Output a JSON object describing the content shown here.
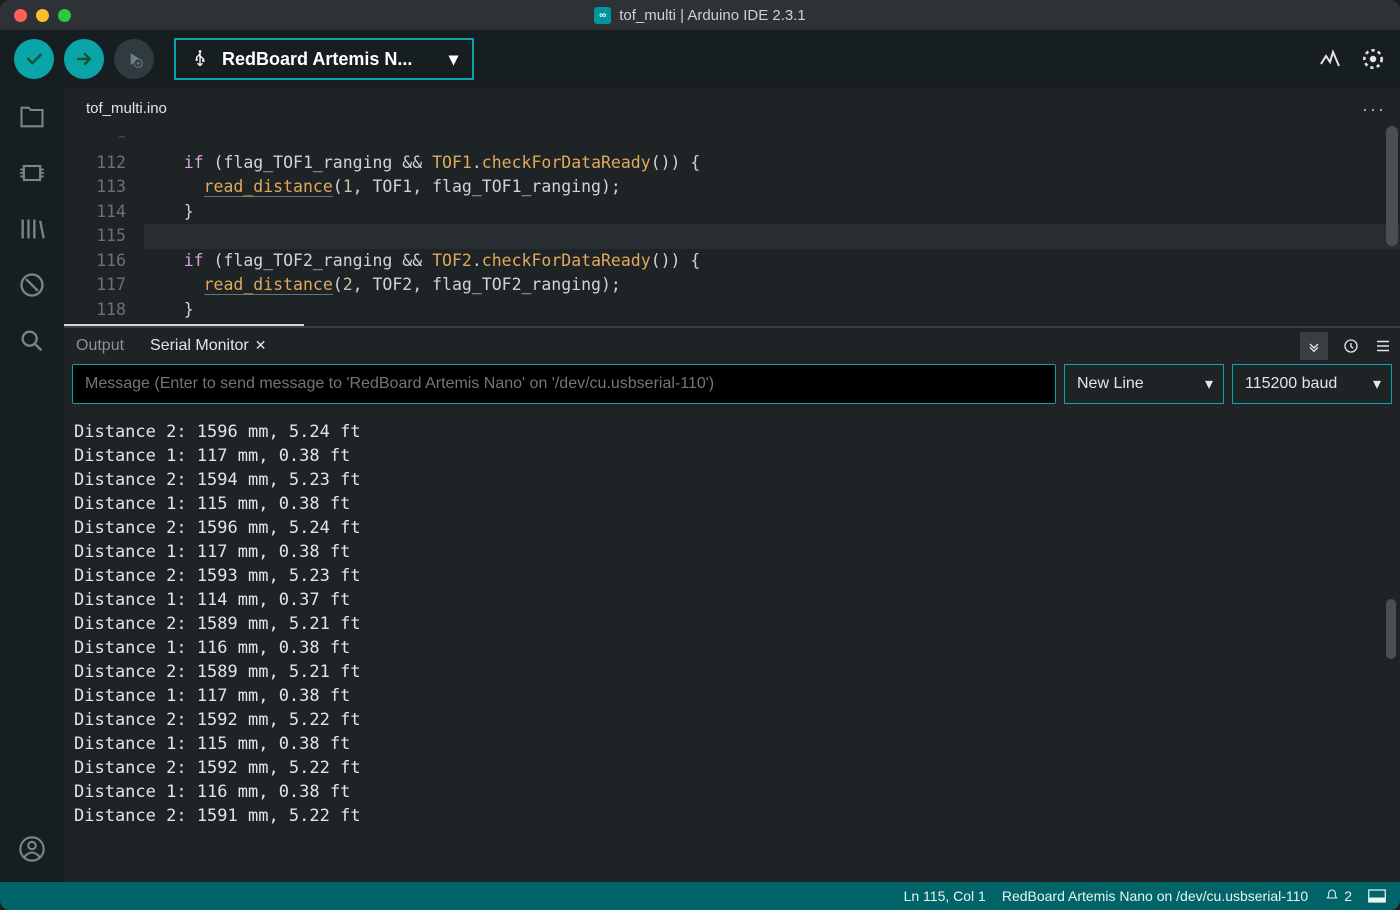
{
  "window": {
    "title": "tof_multi | Arduino IDE 2.3.1"
  },
  "toolbar": {
    "board_label": "RedBoard Artemis N..."
  },
  "tabs": {
    "editor_tab": "tof_multi.ino"
  },
  "editor": {
    "lines": [
      {
        "num": "112",
        "t": "if",
        "rest": " (flag_TOF1_ranging && ",
        "obj": "TOF1",
        "dot": ".",
        "call": "checkForDataReady",
        "tail": "()) {"
      },
      {
        "num": "113",
        "fn": "read_distance",
        "args": "(1, TOF1, flag_TOF1_ranging);",
        "argnum": "1"
      },
      {
        "num": "114",
        "text": "}"
      },
      {
        "num": "115",
        "text": ""
      },
      {
        "num": "116",
        "t": "if",
        "rest": " (flag_TOF2_ranging && ",
        "obj": "TOF2",
        "dot": ".",
        "call": "checkForDataReady",
        "tail": "()) {"
      },
      {
        "num": "117",
        "fn": "read_distance",
        "args": "(2, TOF2, flag_TOF2_ranging);",
        "argnum": "2"
      },
      {
        "num": "118",
        "text": "}"
      }
    ]
  },
  "panel": {
    "tab_output": "Output",
    "tab_serial": "Serial Monitor",
    "msg_placeholder": "Message (Enter to send message to 'RedBoard Artemis Nano' on '/dev/cu.usbserial-110')",
    "line_ending": "New Line",
    "baud": "115200 baud",
    "serial_lines": [
      "Distance 2: 1596 mm, 5.24 ft",
      "Distance 1: 117 mm, 0.38 ft",
      "Distance 2: 1594 mm, 5.23 ft",
      "Distance 1: 115 mm, 0.38 ft",
      "Distance 2: 1596 mm, 5.24 ft",
      "Distance 1: 117 mm, 0.38 ft",
      "Distance 2: 1593 mm, 5.23 ft",
      "Distance 1: 114 mm, 0.37 ft",
      "Distance 2: 1589 mm, 5.21 ft",
      "Distance 1: 116 mm, 0.38 ft",
      "Distance 2: 1589 mm, 5.21 ft",
      "Distance 1: 117 mm, 0.38 ft",
      "Distance 2: 1592 mm, 5.22 ft",
      "Distance 1: 115 mm, 0.38 ft",
      "Distance 2: 1592 mm, 5.22 ft",
      "Distance 1: 116 mm, 0.38 ft",
      "Distance 2: 1591 mm, 5.22 ft"
    ]
  },
  "status": {
    "cursor": "Ln 115, Col 1",
    "board": "RedBoard Artemis Nano on /dev/cu.usbserial-110",
    "notif_count": "2"
  }
}
